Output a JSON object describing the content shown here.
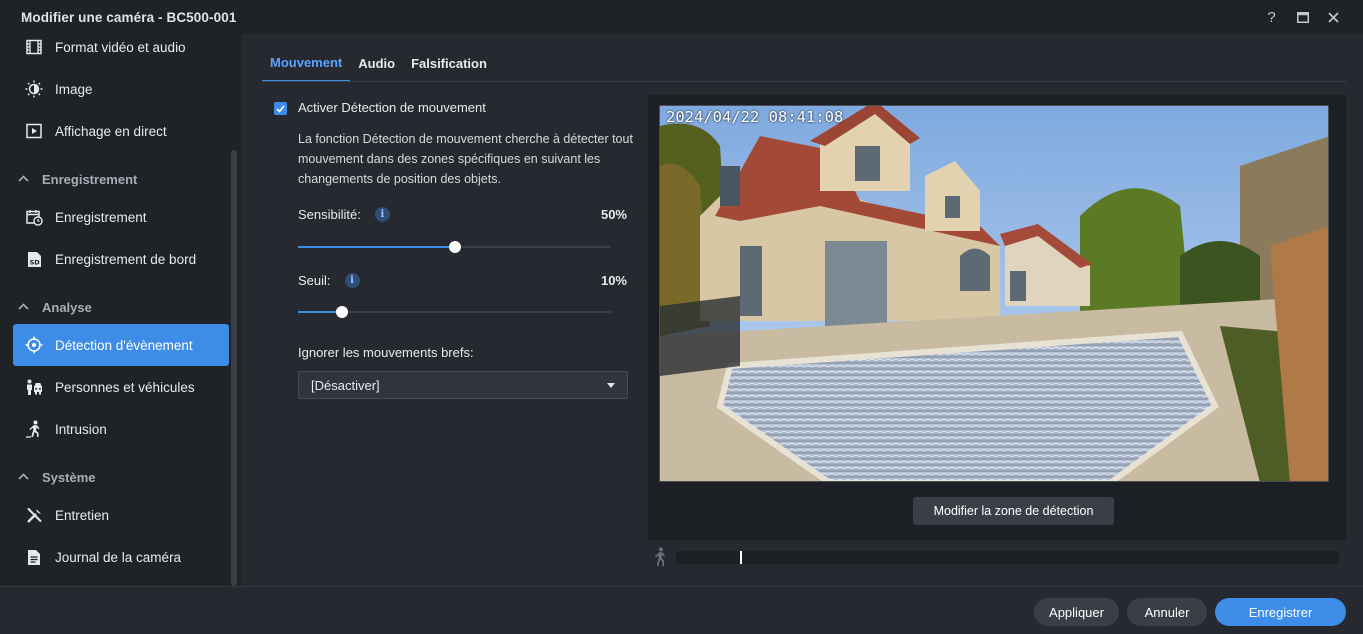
{
  "window": {
    "title": "Modifier une caméra - BC500-001",
    "controls": [
      "help-icon",
      "maximize-icon",
      "close-icon"
    ]
  },
  "sidebar": {
    "items": [
      {
        "label": "Format vidéo et audio",
        "icon": "film-icon"
      },
      {
        "label": "Image",
        "icon": "brightness-icon"
      },
      {
        "label": "Affichage en direct",
        "icon": "play-icon"
      },
      {
        "group": "Enregistrement"
      },
      {
        "label": "Enregistrement",
        "icon": "record-schedule-icon"
      },
      {
        "label": "Enregistrement de bord",
        "icon": "sd-card-icon"
      },
      {
        "group": "Analyse"
      },
      {
        "label": "Détection d'évènement",
        "icon": "crosshair-icon",
        "active": true
      },
      {
        "label": "Personnes et véhicules",
        "icon": "person-vehicle-icon"
      },
      {
        "label": "Intrusion",
        "icon": "intrusion-icon"
      },
      {
        "group": "Système"
      },
      {
        "label": "Entretien",
        "icon": "tools-icon"
      },
      {
        "label": "Journal de la caméra",
        "icon": "log-icon"
      }
    ]
  },
  "tabs": [
    {
      "label": "Mouvement",
      "active": true
    },
    {
      "label": "Audio"
    },
    {
      "label": "Falsification"
    }
  ],
  "motion": {
    "enable_label": "Activer Détection de mouvement",
    "enabled": true,
    "description": "La fonction Détection de mouvement cherche à détecter tout mouvement dans des zones spécifiques en suivant les changements de position des objets.",
    "sensitivity": {
      "label": "Sensibilité:",
      "value_text": "50%",
      "value": 0.5
    },
    "threshold": {
      "label": "Seuil:",
      "value_text": "10%",
      "value": 0.1
    },
    "ignore_label": "Ignorer les mouvements brefs:",
    "ignore_value": "[Désactiver]"
  },
  "preview": {
    "timestamp": "2024/04/22 08:41:08",
    "edit_zone_label": "Modifier la zone de détection"
  },
  "footer": {
    "apply": "Appliquer",
    "cancel": "Annuler",
    "save": "Enregistrer"
  },
  "colors": {
    "accent": "#3d8ce8",
    "background": "#262a30",
    "sidebar": "#1f2227"
  }
}
